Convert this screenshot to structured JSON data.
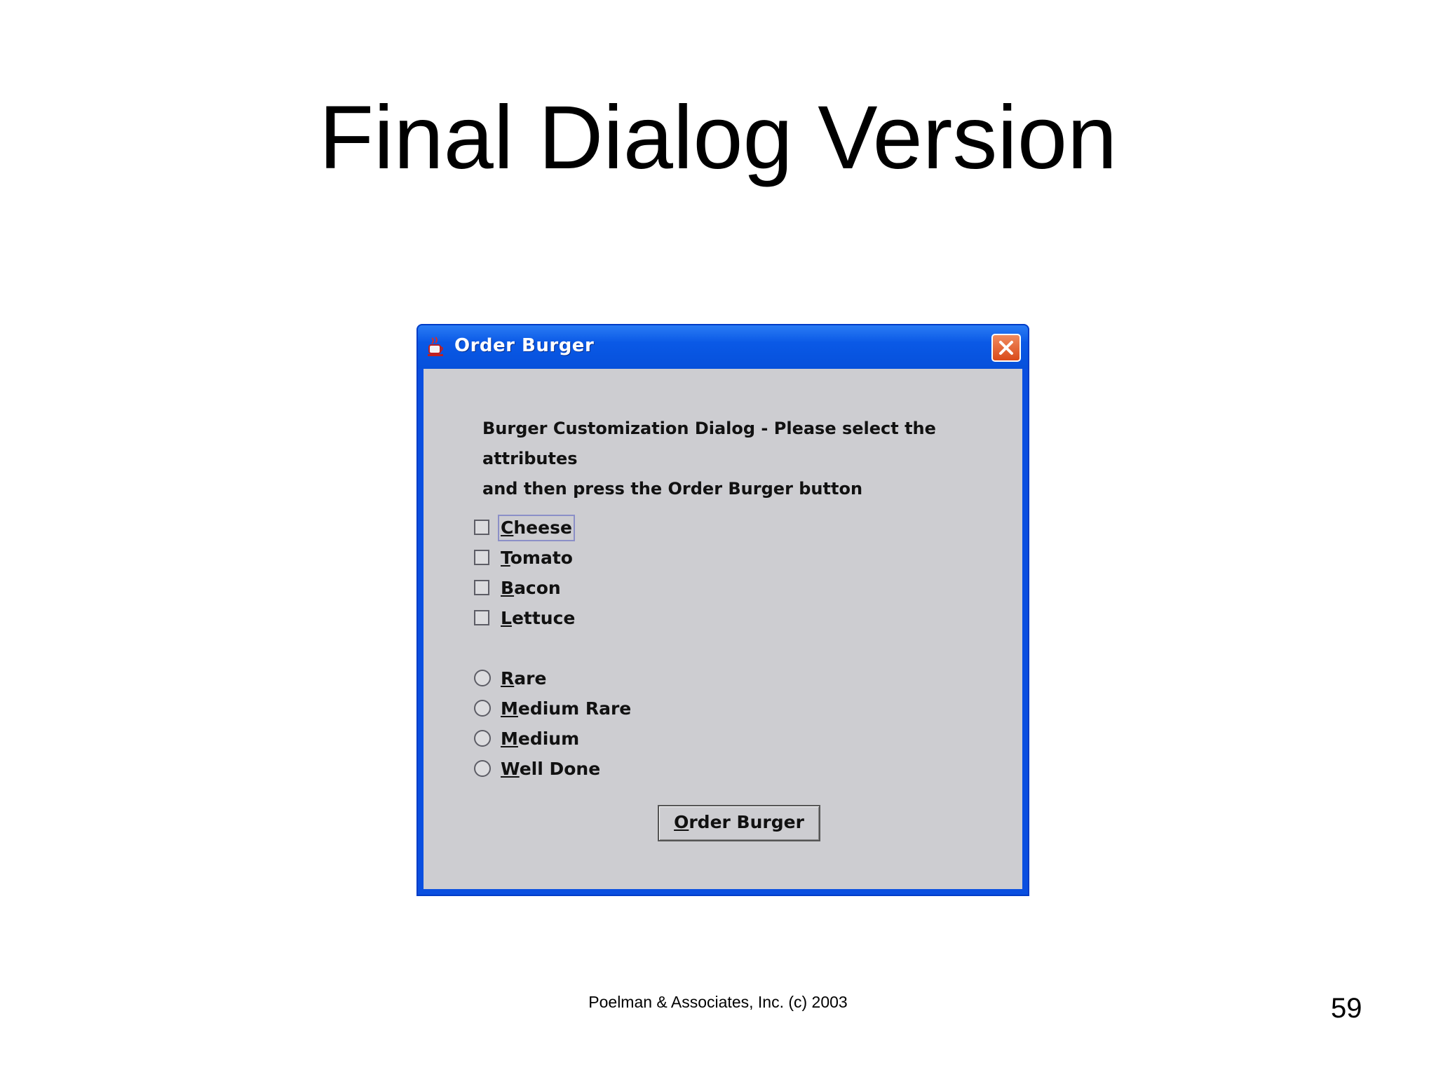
{
  "slide": {
    "title": "Final Dialog Version",
    "footer": "Poelman & Associates, Inc. (c) 2003",
    "page_number": "59"
  },
  "dialog": {
    "title": "Order Burger",
    "icon": "java-cup-icon",
    "prompt_line1": "Burger Customization Dialog - Please select the attributes",
    "prompt_line2": "and then press the Order Burger button",
    "toppings": [
      {
        "label": "Cheese",
        "checked": false
      },
      {
        "label": "Tomato",
        "checked": false
      },
      {
        "label": "Bacon",
        "checked": false
      },
      {
        "label": "Lettuce",
        "checked": false
      }
    ],
    "doneness": [
      {
        "label": "Rare",
        "selected": false
      },
      {
        "label": "Medium Rare",
        "selected": false
      },
      {
        "label": "Medium",
        "selected": false
      },
      {
        "label": "Well Done",
        "selected": false
      }
    ],
    "order_button_label": "Order Burger"
  },
  "colors": {
    "titlebar": "#0a59e6",
    "close_button": "#d94a1a",
    "client_bg": "#cdcdd1"
  }
}
